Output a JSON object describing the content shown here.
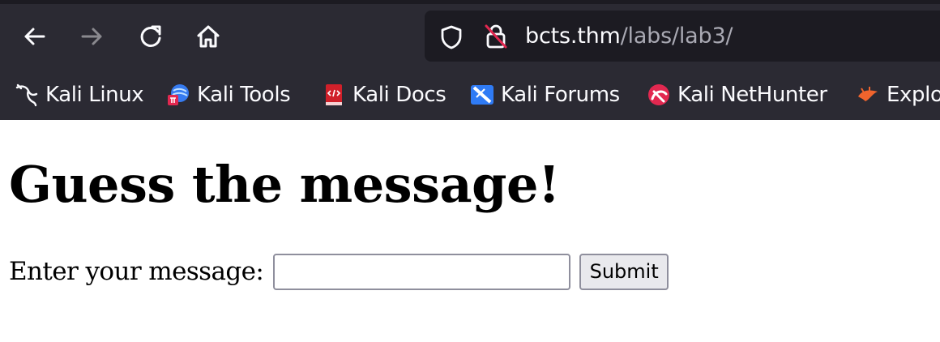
{
  "browser": {
    "nav": {
      "back_icon": "arrow-left-icon",
      "forward_icon": "arrow-right-icon",
      "reload_icon": "reload-icon",
      "home_icon": "home-icon"
    },
    "url": {
      "host": "bcts.thm",
      "path": "/labs/lab3/",
      "shield_icon": "shield-icon",
      "insecure_lock_icon": "insecure-lock-icon"
    },
    "bookmarks": [
      {
        "label": "Kali Linux",
        "icon": "kali-dragon-icon"
      },
      {
        "label": "Kali Tools",
        "icon": "kali-tools-icon"
      },
      {
        "label": "Kali Docs",
        "icon": "kali-docs-icon"
      },
      {
        "label": "Kali Forums",
        "icon": "kali-forums-icon"
      },
      {
        "label": "Kali NetHunter",
        "icon": "kali-nethunter-icon"
      },
      {
        "label": "Explo",
        "icon": "exploit-db-icon"
      }
    ],
    "colors": {
      "chrome_bg": "#2b2a33",
      "url_bg": "#1c1b22",
      "text": "#fbfbfe",
      "muted_text": "#a9a9b3"
    }
  },
  "page": {
    "title": "Guess the message!",
    "form": {
      "label": "Enter your message:",
      "input_value": "",
      "submit_label": "Submit"
    }
  }
}
